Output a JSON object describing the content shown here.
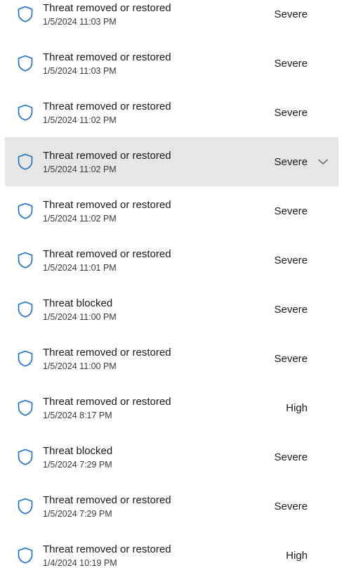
{
  "colors": {
    "shield_stroke": "#1a6fc9",
    "selected_background": "#e6e6e6"
  },
  "icons": {
    "shield": "shield-icon",
    "chevron": "chevron-down-icon"
  },
  "protection_history": {
    "items": [
      {
        "title": "Threat removed or restored",
        "time": "1/5/2024 11:03 PM",
        "severity": "Severe"
      },
      {
        "title": "Threat removed or restored",
        "time": "1/5/2024 11:03 PM",
        "severity": "Severe"
      },
      {
        "title": "Threat removed or restored",
        "time": "1/5/2024 11:02 PM",
        "severity": "Severe"
      },
      {
        "title": "Threat removed or restored",
        "time": "1/5/2024 11:02 PM",
        "severity": "Severe",
        "selected": true
      },
      {
        "title": "Threat removed or restored",
        "time": "1/5/2024 11:02 PM",
        "severity": "Severe"
      },
      {
        "title": "Threat removed or restored",
        "time": "1/5/2024 11:01 PM",
        "severity": "Severe"
      },
      {
        "title": "Threat blocked",
        "time": "1/5/2024 11:00 PM",
        "severity": "Severe"
      },
      {
        "title": "Threat removed or restored",
        "time": "1/5/2024 11:00 PM",
        "severity": "Severe"
      },
      {
        "title": "Threat removed or restored",
        "time": "1/5/2024 8:17 PM",
        "severity": "High"
      },
      {
        "title": "Threat blocked",
        "time": "1/5/2024 7:29 PM",
        "severity": "Severe"
      },
      {
        "title": "Threat removed or restored",
        "time": "1/5/2024 7:29 PM",
        "severity": "Severe"
      },
      {
        "title": "Threat removed or restored",
        "time": "1/4/2024 10:19 PM",
        "severity": "High"
      }
    ]
  }
}
